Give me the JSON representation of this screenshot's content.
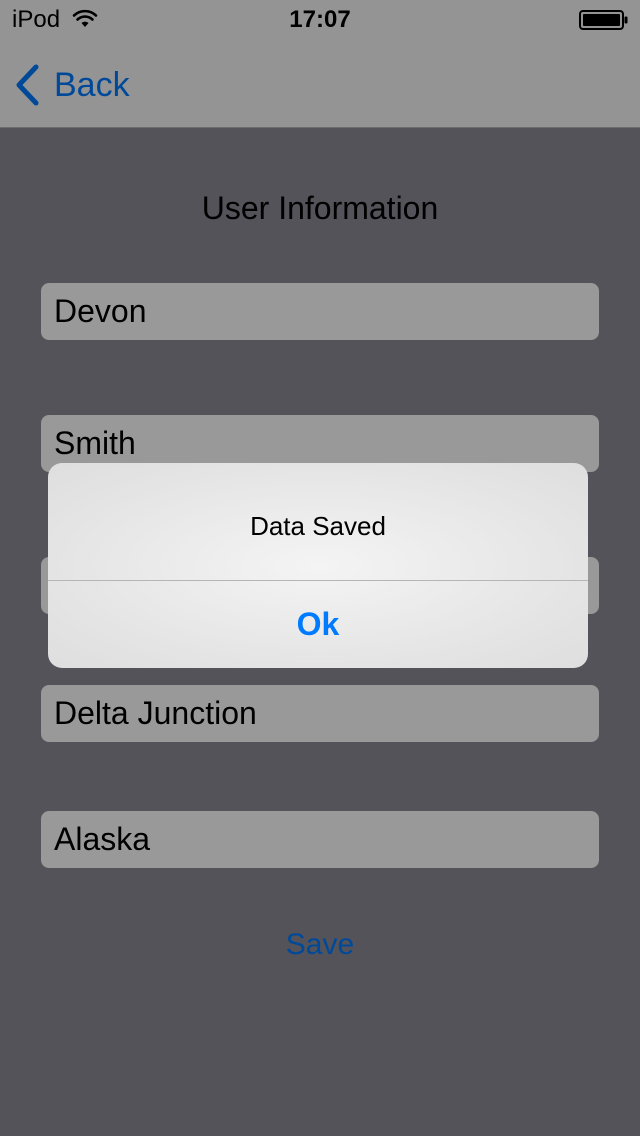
{
  "status_bar": {
    "carrier": "iPod",
    "time": "17:07",
    "wifi_icon": "wifi-icon",
    "battery_icon": "battery-icon"
  },
  "nav_bar": {
    "back_label": "Back",
    "back_icon": "chevron-left-icon"
  },
  "form": {
    "title": "User Information",
    "fields": [
      {
        "value": "Devon"
      },
      {
        "value": "Smith"
      },
      {
        "value": ""
      },
      {
        "value": "Delta Junction"
      },
      {
        "value": "Alaska"
      }
    ],
    "save_label": "Save"
  },
  "alert": {
    "message": "Data Saved",
    "ok_label": "Ok"
  },
  "colors": {
    "accent": "#007aff",
    "content_background": "#8a8a95",
    "field_background": "#ffffff"
  }
}
